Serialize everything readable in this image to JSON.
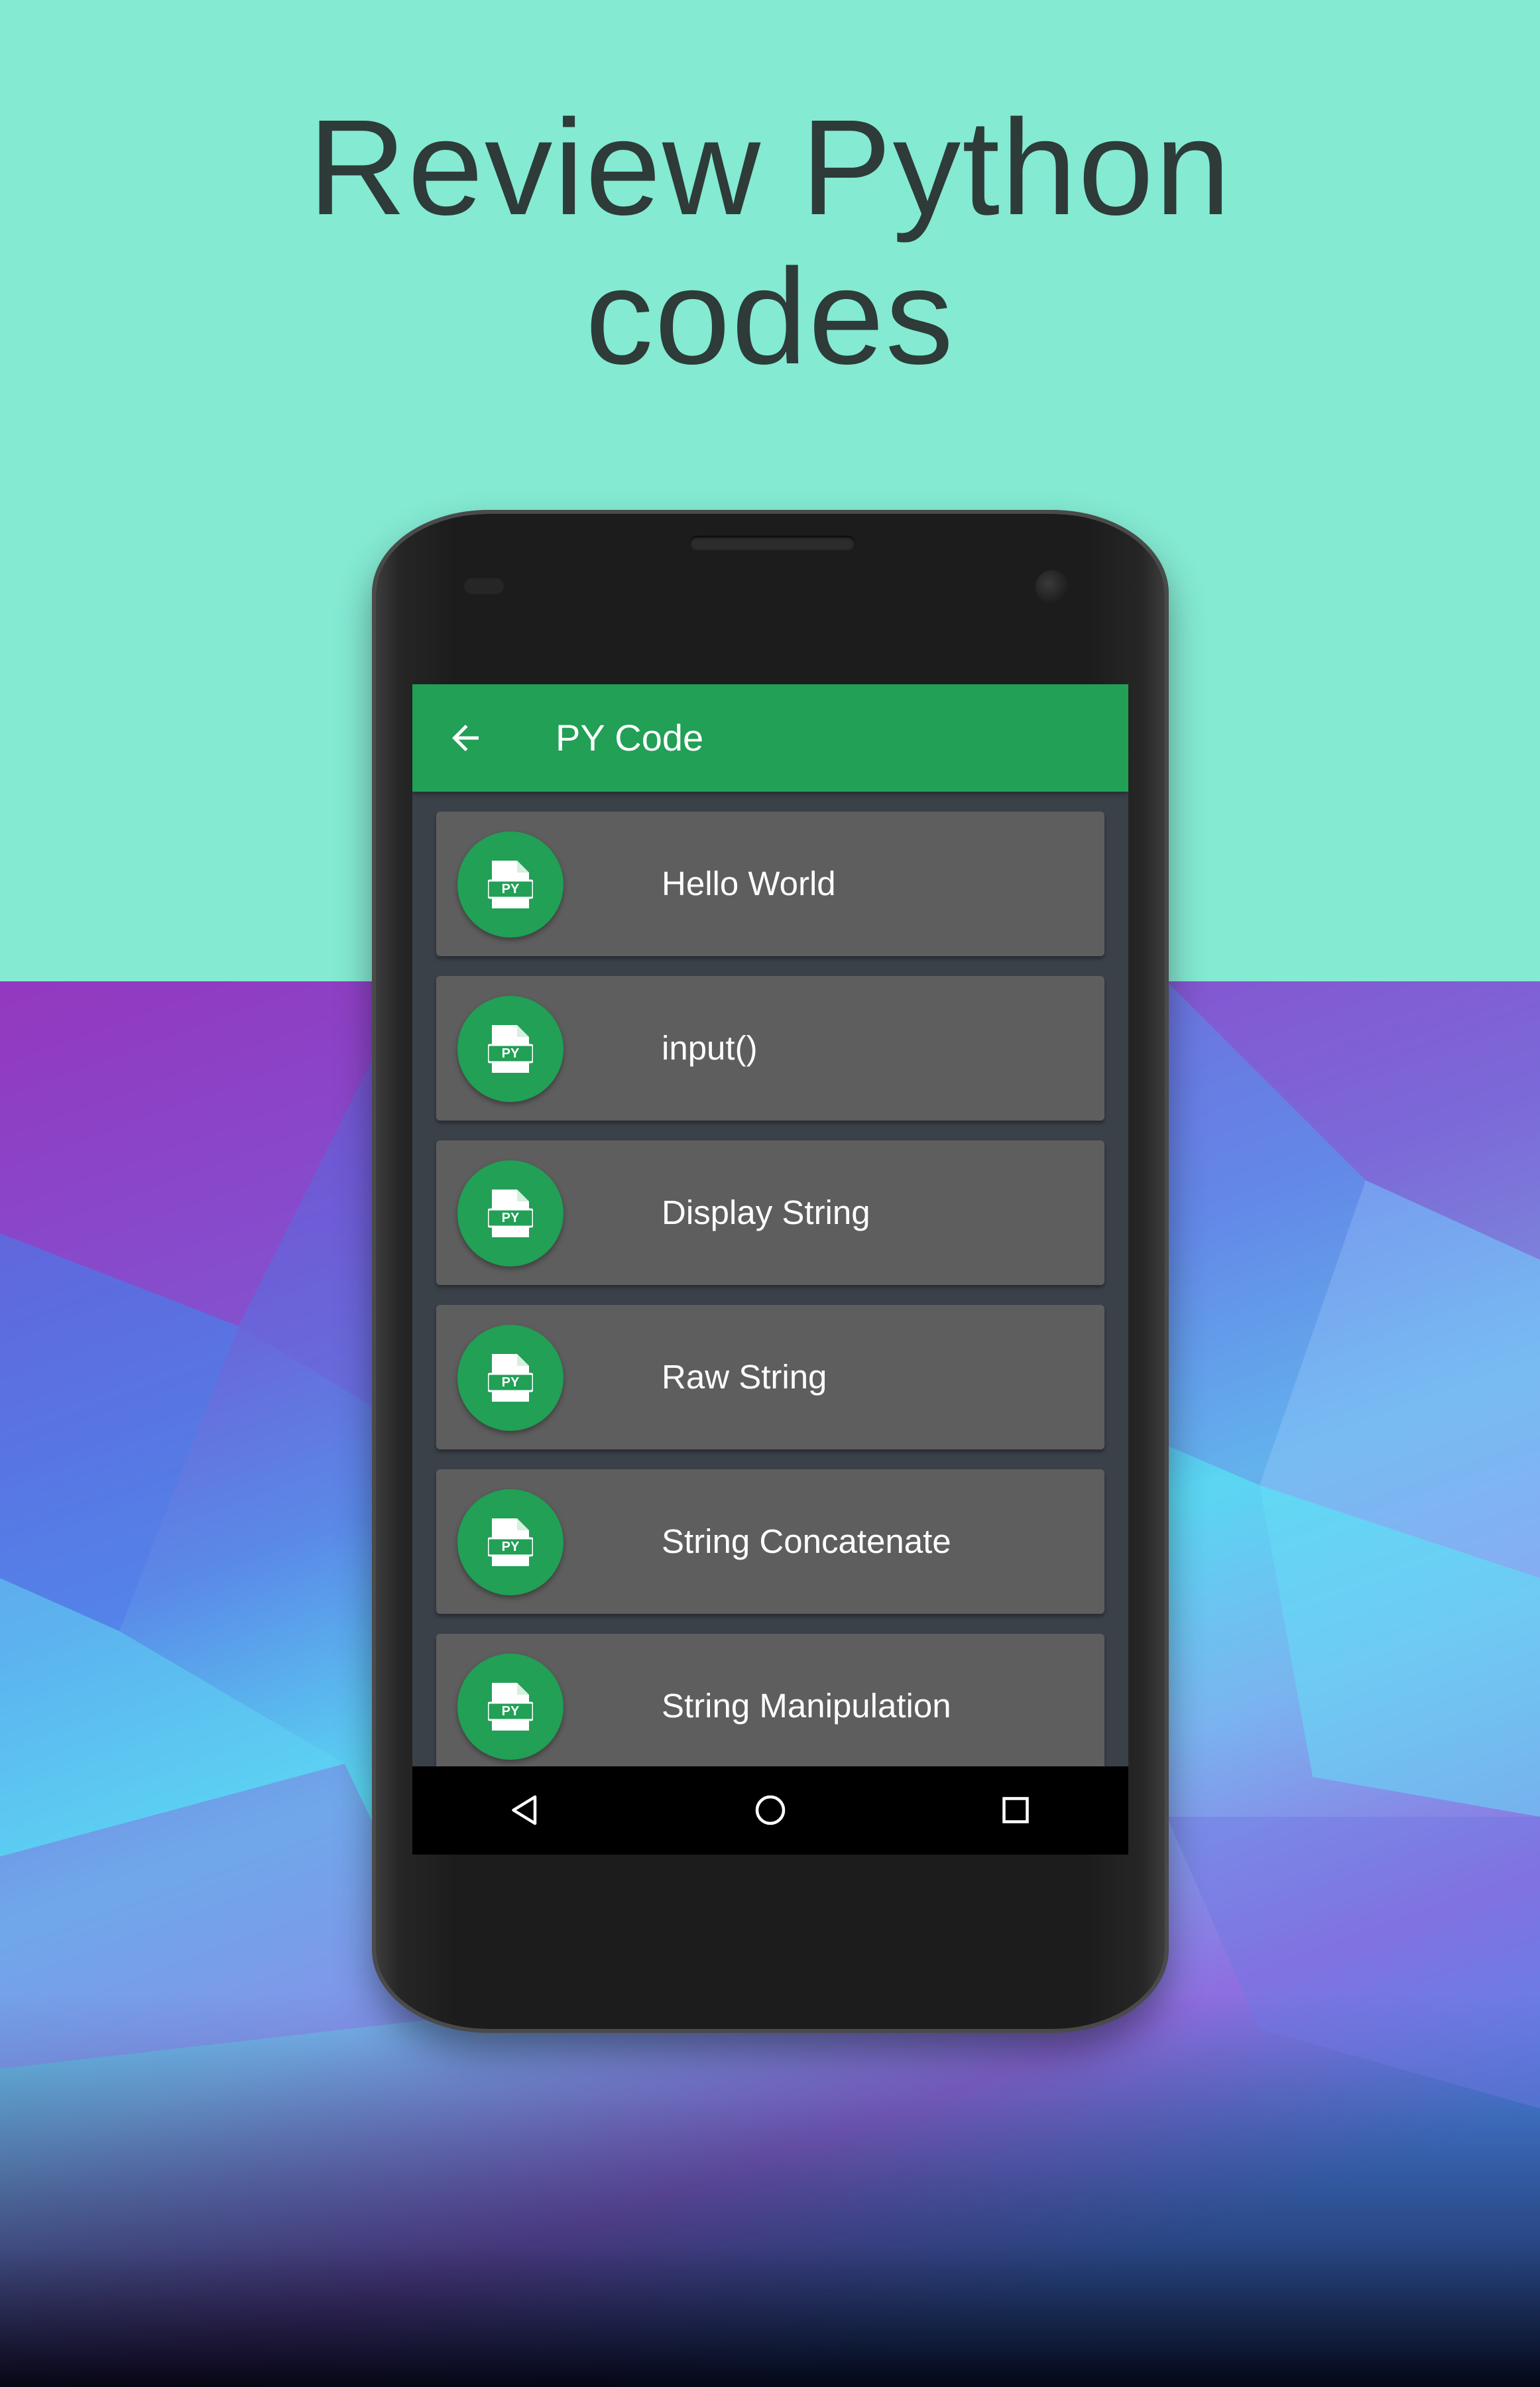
{
  "headline": {
    "line1": "Review Python",
    "line2": "codes"
  },
  "colors": {
    "top_background": "#84ead2",
    "app_bar": "#21a056",
    "card": "#5e5e5e",
    "screen": "#3a4149",
    "nav_bar": "#000000"
  },
  "app": {
    "title": "PY Code",
    "back_icon": "arrow-left-icon",
    "items": [
      {
        "label": "Hello World",
        "icon": "py-file-icon",
        "icon_text": "PY"
      },
      {
        "label": "input()",
        "icon": "py-file-icon",
        "icon_text": "PY"
      },
      {
        "label": "Display String",
        "icon": "py-file-icon",
        "icon_text": "PY"
      },
      {
        "label": "Raw String",
        "icon": "py-file-icon",
        "icon_text": "PY"
      },
      {
        "label": "String Concatenate",
        "icon": "py-file-icon",
        "icon_text": "PY"
      },
      {
        "label": "String Manipulation",
        "icon": "py-file-icon",
        "icon_text": "PY"
      }
    ]
  },
  "navbar": {
    "back": "nav-back-icon",
    "home": "nav-home-icon",
    "recents": "nav-recents-icon"
  }
}
